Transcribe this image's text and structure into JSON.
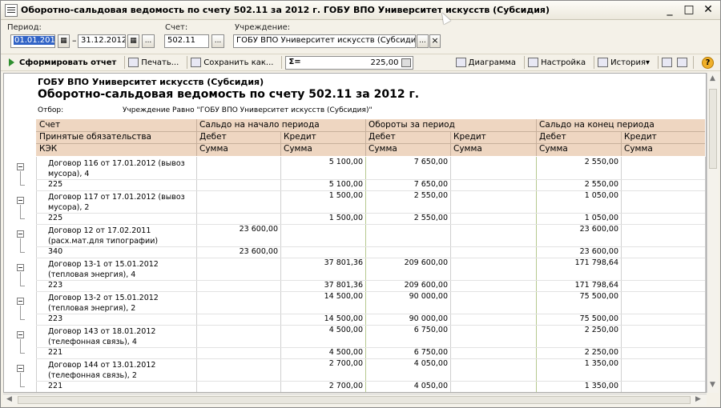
{
  "window": {
    "title": "Оборотно-сальдовая ведомость по счету 502.11 за 2012 г. ГОБУ ВПО Университет искусств (Субсидия)",
    "minimize_icon": "minimize-icon",
    "maximize_icon": "maximize-icon",
    "close_icon": "close-icon"
  },
  "filters": {
    "period_label": "Период:",
    "period_from": "01.01.2012",
    "dash": "–",
    "period_to": "31.12.2012",
    "account_label": "Счет:",
    "account_value": "502.11",
    "institution_label": "Учреждение:",
    "institution_value": "ГОБУ ВПО Университет искусств (Субсидия)",
    "dots": "...",
    "clear": "×"
  },
  "toolbar": {
    "generate": "Сформировать отчет",
    "print": "Печать...",
    "save": "Сохранить как...",
    "sum_symbol": "Σ=",
    "sum_value": "225,00",
    "chart": "Диаграмма",
    "settings": "Настройка",
    "history": "История",
    "history_arrow": "▾",
    "help": "?"
  },
  "report": {
    "org": "ГОБУ ВПО Университет искусств (Субсидия)",
    "title": "Оборотно-сальдовая ведомость по счету 502.11 за 2012 г.",
    "filter_label": "Отбор:",
    "filter_value": "Учреждение Равно \"ГОБУ ВПО Университет искусств (Субсидия)\"",
    "header": {
      "row1": [
        "Счет",
        "Сальдо на начало периода",
        "Обороты за период",
        "Сальдо на конец периода"
      ],
      "row2": [
        "Принятые обязательства",
        "Дебет",
        "Кредит",
        "Дебет",
        "Кредит",
        "Дебет",
        "Кредит"
      ],
      "row3": [
        "КЭК",
        "Сумма",
        "Сумма",
        "Сумма",
        "Сумма",
        "Сумма",
        "Сумма"
      ]
    },
    "rows": [
      {
        "name": "Договор 116 от 17.01.2012 (вывоз мусора), 4",
        "kek": "225",
        "sn_d": "",
        "sn_k": "",
        "ob_d": "5 100,00",
        "ob_k": "7 650,00",
        "sk_d": "",
        "sk_k": "2 550,00"
      },
      {
        "name": "Договор 117 от 17.01.2012 (вывоз мусора), 2",
        "kek": "225",
        "sn_d": "",
        "sn_k": "",
        "ob_d": "1 500,00",
        "ob_k": "2 550,00",
        "sk_d": "",
        "sk_k": "1 050,00"
      },
      {
        "name": "Договор 12 от 17.02.2011 (расх.мат.для типографии)",
        "kek": "340",
        "sn_d": "",
        "sn_k": "23 600,00",
        "ob_d": "",
        "ob_k": "",
        "sk_d": "",
        "sk_k": "23 600,00"
      },
      {
        "name": "Договор 13-1 от 15.01.2012 (тепловая энергия), 4",
        "kek": "223",
        "sn_d": "",
        "sn_k": "",
        "ob_d": "37 801,36",
        "ob_k": "209 600,00",
        "sk_d": "",
        "sk_k": "171 798,64"
      },
      {
        "name": "Договор 13-2 от 15.01.2012 (тепловая энергия), 2",
        "kek": "223",
        "sn_d": "",
        "sn_k": "",
        "ob_d": "14 500,00",
        "ob_k": "90 000,00",
        "sk_d": "",
        "sk_k": "75 500,00"
      },
      {
        "name": "Договор 143 от 18.01.2012 (телефонная связь), 4",
        "kek": "221",
        "sn_d": "",
        "sn_k": "",
        "ob_d": "4 500,00",
        "ob_k": "6 750,00",
        "sk_d": "",
        "sk_k": "2 250,00"
      },
      {
        "name": "Договор 144 от 13.01.2012 (телефонная связь), 2",
        "kek": "221",
        "sn_d": "",
        "sn_k": "",
        "ob_d": "2 700,00",
        "ob_k": "4 050,00",
        "sk_d": "",
        "sk_k": "1 350,00"
      }
    ]
  }
}
